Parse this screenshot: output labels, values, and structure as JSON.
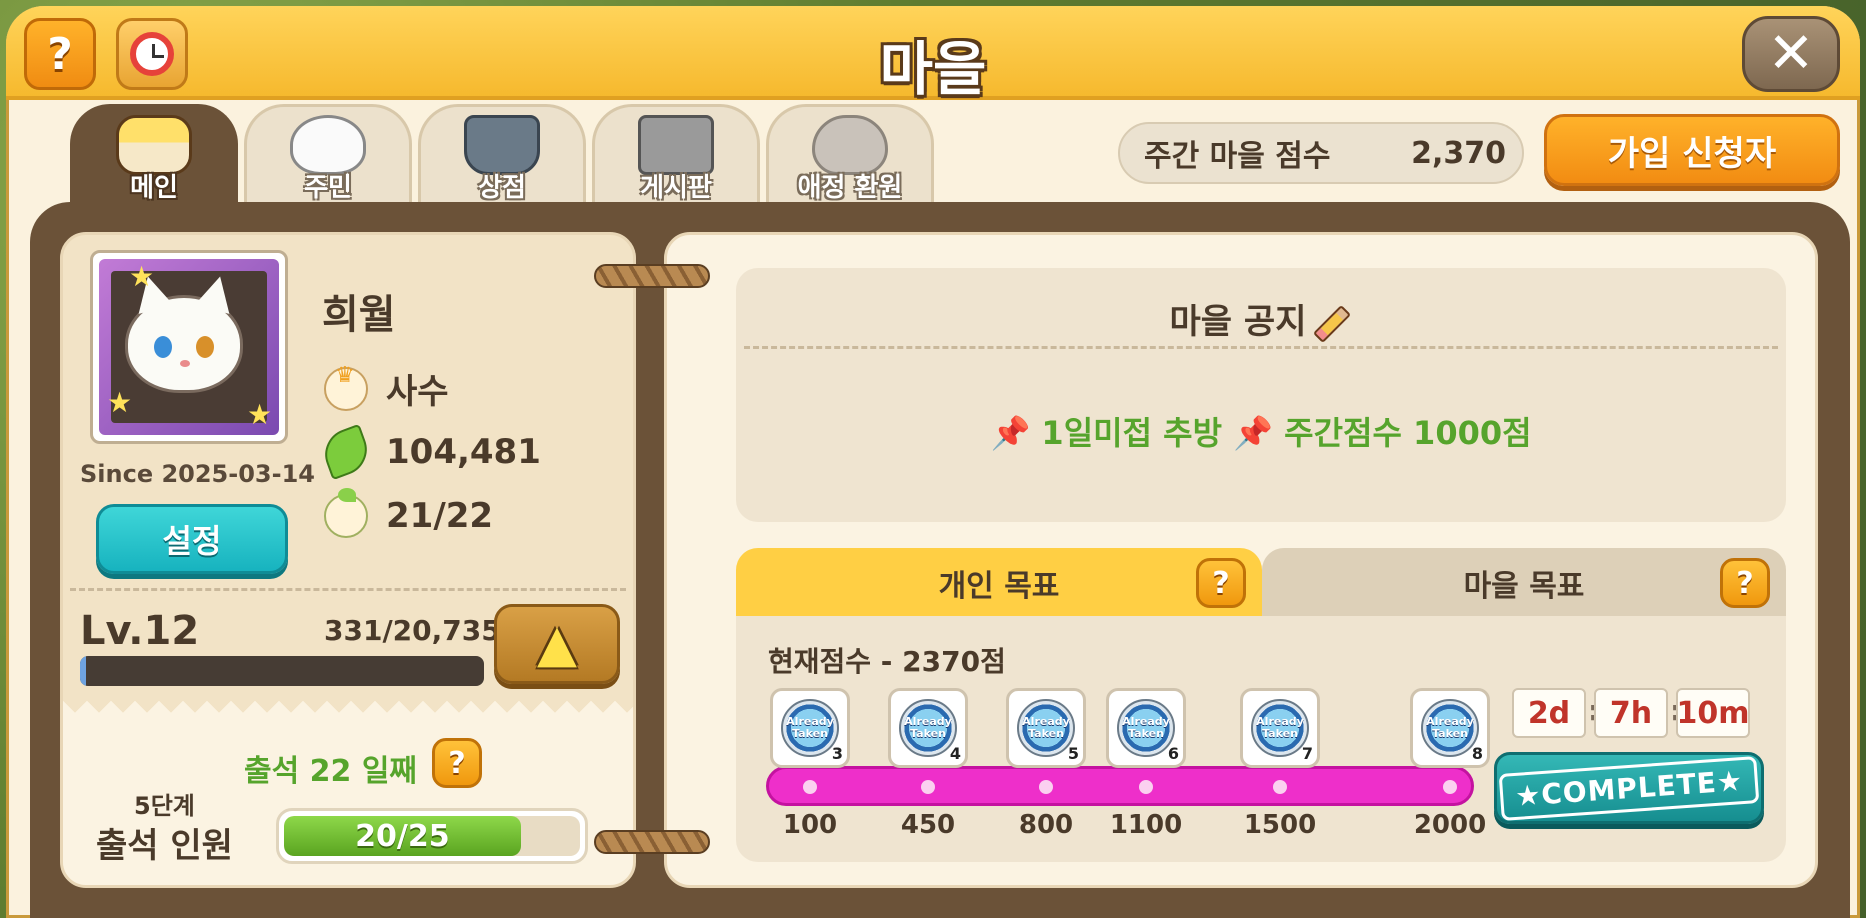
{
  "window": {
    "title": "마을"
  },
  "header": {
    "help_icon_label": "?",
    "close_icon_label": "✕"
  },
  "tabs": [
    {
      "label": "메인",
      "icon": "house-icon",
      "active": true
    },
    {
      "label": "주민",
      "icon": "resident-icon",
      "active": false
    },
    {
      "label": "상점",
      "icon": "basket-icon",
      "active": false
    },
    {
      "label": "게시판",
      "icon": "board-icon",
      "active": false
    },
    {
      "label": "애정 환원",
      "icon": "heart-icon",
      "active": false
    }
  ],
  "weekly_score": {
    "label": "주간 마을 점수",
    "value": "2,370"
  },
  "apply_button": {
    "label": "가입 신청자"
  },
  "profile": {
    "name": "희월",
    "role": "사수",
    "leaves": "104,481",
    "members": "21/22",
    "since": "Since 2025-03-14",
    "settings_label": "설정",
    "level": "Lv.12",
    "xp": "331/20,735",
    "xp_progress": 0.016,
    "up_icon": "▲"
  },
  "attendance": {
    "label": "출석 22 일째",
    "stage": "5단계",
    "members_label": "출석 인원",
    "count": "20/25",
    "progress": 0.8
  },
  "notice": {
    "title": "마을 공지",
    "text_1": "1일미접 추방",
    "text_2": "주간점수 1000점",
    "pin_icon": "📌"
  },
  "goals": {
    "personal_tab": "개인 목표",
    "village_tab": "마을 목표",
    "current_score": "현재점수 - 2370점",
    "badge_text": "Already Taken",
    "milestones": [
      {
        "value": "100",
        "badge_num": "3"
      },
      {
        "value": "450",
        "badge_num": "4"
      },
      {
        "value": "800",
        "badge_num": "5"
      },
      {
        "value": "1100",
        "badge_num": "6"
      },
      {
        "value": "1500",
        "badge_num": "7"
      },
      {
        "value": "2000",
        "badge_num": "8"
      }
    ],
    "timer": {
      "days": "2d",
      "hours": "7h",
      "minutes": "10m"
    },
    "complete_label": "★COMPLETE★"
  },
  "colors": {
    "accent_orange": "#f28c12",
    "teal": "#17b3bf",
    "green_text": "#56a42c",
    "progress_pink": "#ee2fca"
  }
}
